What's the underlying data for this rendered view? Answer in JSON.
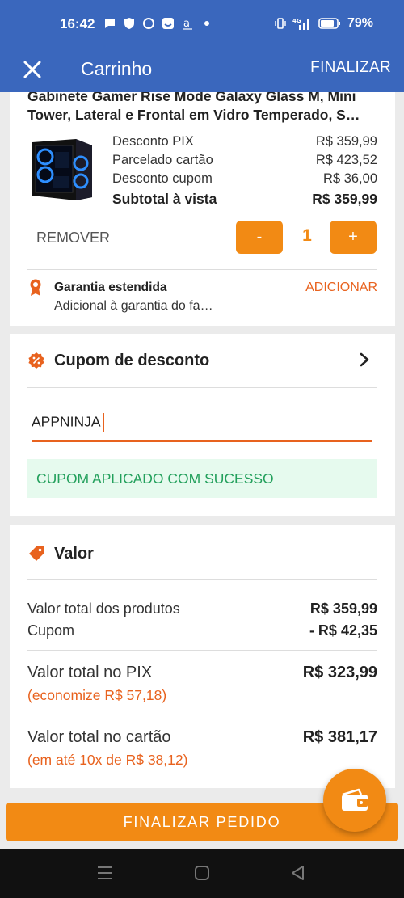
{
  "status_bar": {
    "time": "16:42",
    "battery": "79%",
    "network": "4G"
  },
  "app_bar": {
    "title": "Carrinho",
    "action": "FINALIZAR",
    "close_icon": "close-icon"
  },
  "product": {
    "title": "Gabinete Gamer Rise Mode Galaxy Glass M, Mini Tower, Lateral e Frontal em Vidro Temperado, S…",
    "prices": [
      {
        "label": "Desconto PIX",
        "value": "R$ 359,99"
      },
      {
        "label": "Parcelado cartão",
        "value": "R$ 423,52"
      },
      {
        "label": "Desconto cupom",
        "value": "R$ 36,00"
      }
    ],
    "subtotal_label": "Subtotal à vista",
    "subtotal_value": "R$ 359,99",
    "remove_label": "REMOVER",
    "minus_label": "-",
    "plus_label": "+",
    "quantity": "1",
    "warranty_title": "Garantia estendida",
    "warranty_desc": "Adicional à garantia do fa…",
    "warranty_action": "ADICIONAR"
  },
  "coupon": {
    "title": "Cupom de desconto",
    "code": "APPNINJA",
    "success": "CUPOM APLICADO COM SUCESSO"
  },
  "valor": {
    "title": "Valor",
    "total_produtos_label": "Valor total dos produtos",
    "total_produtos_value": "R$ 359,99",
    "cupom_label": "Cupom",
    "cupom_value": "- R$ 42,35",
    "pix_label": "Valor total no PIX",
    "pix_value": "R$ 323,99",
    "pix_note": "(economize R$ 57,18)",
    "cartao_label": "Valor total no cartão",
    "cartao_value": "R$ 381,17",
    "cartao_note": "(em até 10x de R$ 38,12)"
  },
  "bottom": {
    "final_button": "FINALIZAR PEDIDO"
  },
  "colors": {
    "primary": "#3a67bd",
    "accent": "#f28a14",
    "accent_text": "#e8621e",
    "success_bg": "#e6faee",
    "success_text": "#23a05c"
  }
}
